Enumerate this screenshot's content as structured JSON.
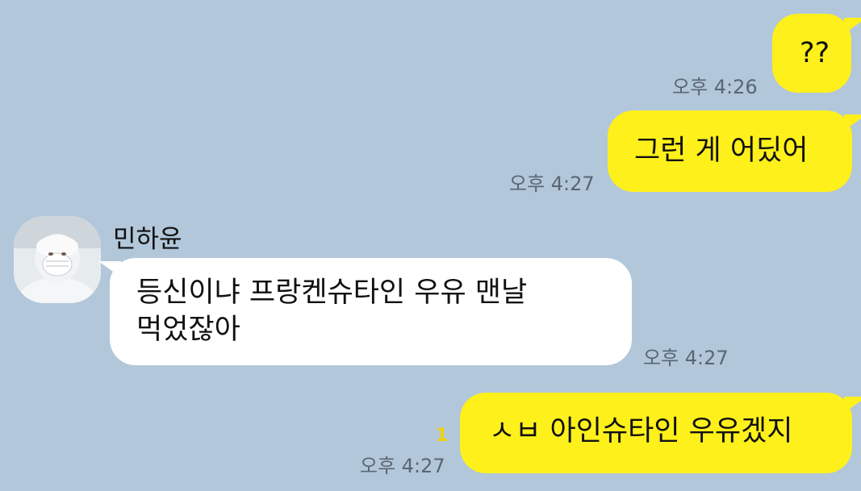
{
  "messages": [
    {
      "id": "m1",
      "from": "me",
      "text": "??",
      "time": "오후 4:26"
    },
    {
      "id": "m2",
      "from": "me",
      "text": "그런 게 어딨어",
      "time": "오후 4:27"
    },
    {
      "id": "m3",
      "from": "them",
      "sender": "민하윤",
      "lines": [
        "등신이냐 프랑켄슈타인 우유 맨날",
        "먹었잖아"
      ],
      "time": "오후 4:27"
    },
    {
      "id": "m4",
      "from": "me",
      "text": "ㅅㅂ 아인슈타인 우유겠지",
      "time": "오후 4:27",
      "unread": "1"
    }
  ],
  "colors": {
    "background": "#b2c7da",
    "my_bubble": "#fef01b",
    "their_bubble": "#ffffff",
    "unread": "#f2d200"
  },
  "icons": {
    "avatar": "profile-photo"
  }
}
